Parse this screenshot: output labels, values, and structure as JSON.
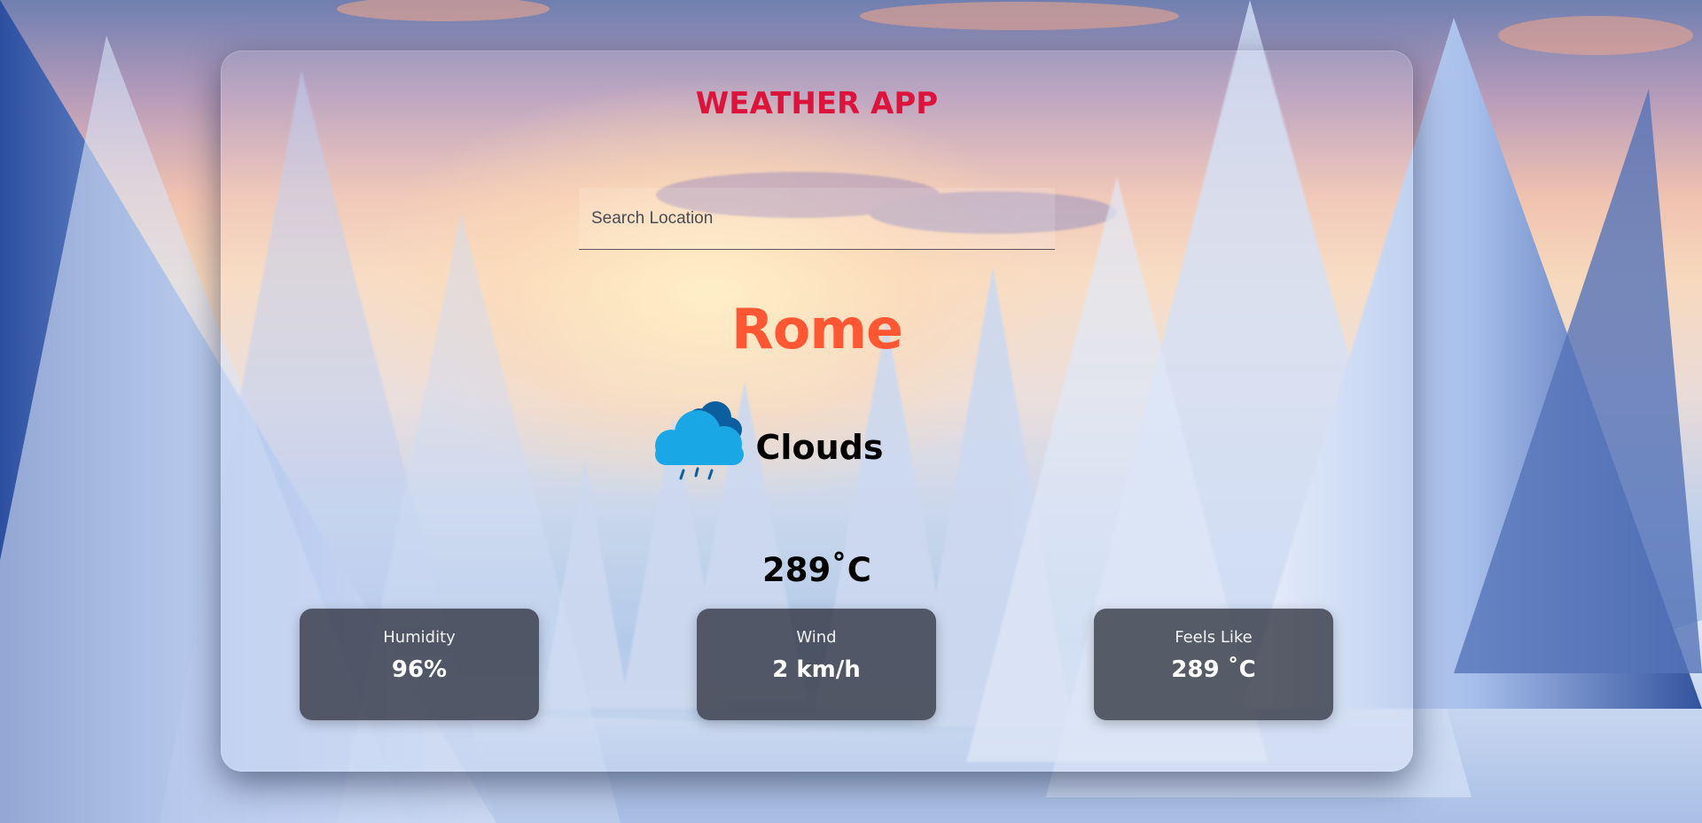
{
  "app": {
    "title": "WEATHER APP"
  },
  "search": {
    "placeholder": "Search Location",
    "value": ""
  },
  "weather": {
    "city": "Rome",
    "condition": "Clouds",
    "condition_icon": "rain-cloud-icon",
    "temperature": "289˚C"
  },
  "stats": [
    {
      "label": "Humidity",
      "value": "96%"
    },
    {
      "label": "Wind",
      "value": "2 km/h"
    },
    {
      "label": "Feels Like",
      "value": "289 ˚C"
    }
  ],
  "colors": {
    "title": "#dc143c",
    "city": "#ff5733",
    "stat_box_bg": "#23262f",
    "cloud_light": "#1aa7e6",
    "cloud_dark": "#0b5f9e"
  }
}
